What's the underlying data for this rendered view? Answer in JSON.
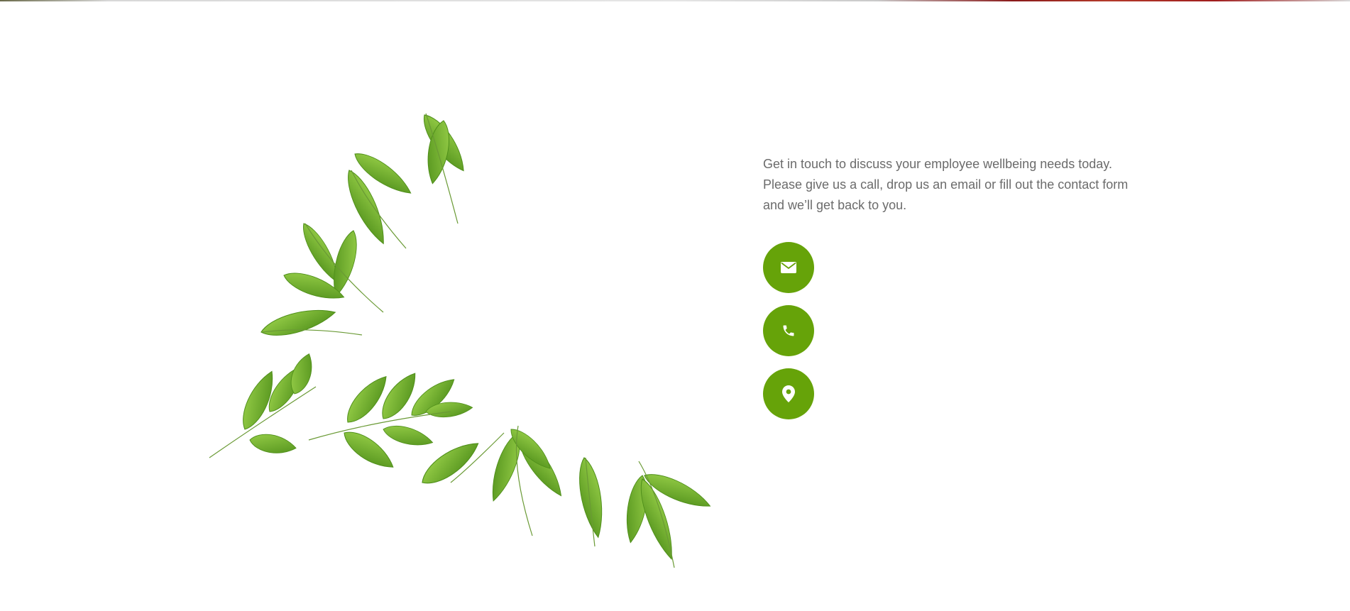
{
  "contact": {
    "intro": "Get in touch to discuss your employee wellbeing needs today. Please give us a call, drop us an email or fill out the contact form and we’ll get back to you.",
    "buttons": [
      {
        "icon": "envelope-icon"
      },
      {
        "icon": "phone-icon"
      },
      {
        "icon": "map-pin-icon"
      }
    ]
  },
  "colors": {
    "accent": "#66a309",
    "text": "#6b6b6b",
    "leaf_light": "#8cc63f",
    "leaf_dark": "#4f8f1a"
  }
}
